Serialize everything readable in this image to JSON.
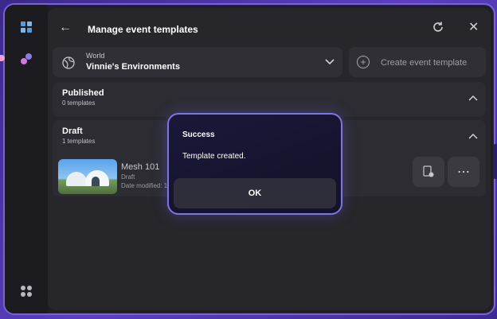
{
  "header": {
    "title": "Manage event templates"
  },
  "world": {
    "label": "World",
    "name": "Vinnie's Environments"
  },
  "create_button": {
    "label": "Create event template"
  },
  "sections": {
    "published": {
      "title": "Published",
      "count": "0 templates"
    },
    "draft": {
      "title": "Draft",
      "count": "1 templates"
    }
  },
  "draft_item": {
    "name": "Mesh 101",
    "status": "Draft",
    "date": "Date modified: 1"
  },
  "dialog": {
    "title": "Success",
    "message": "Template created.",
    "ok_label": "OK"
  },
  "icons": {
    "back": "arrow-left-icon",
    "refresh": "refresh-icon",
    "close": "close-icon",
    "globe": "globe-icon",
    "chevron": "chevron-down-icon",
    "add": "plus-circle-icon",
    "app": "app-grid-icon",
    "details": "document-icon",
    "more": "more-horizontal-icon"
  },
  "colors": {
    "accent": "#7d74e6",
    "background": "#26262b"
  }
}
